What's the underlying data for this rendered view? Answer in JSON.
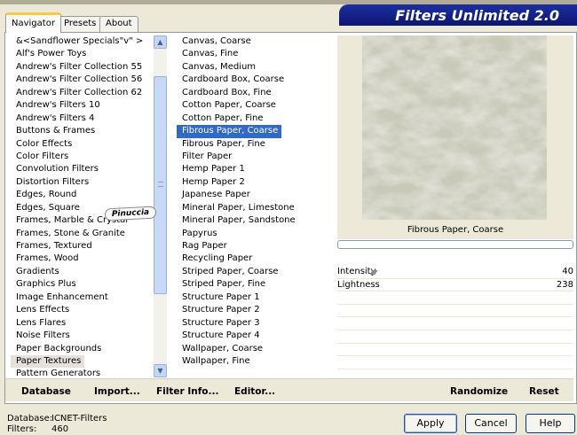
{
  "tabs": [
    "Navigator",
    "Presets",
    "About"
  ],
  "banner": "Filters Unlimited 2.0",
  "categories": [
    "&<Sandflower Specials\"v\" >",
    "Alf's Power Toys",
    "Andrew's Filter Collection 55",
    "Andrew's Filter Collection 56",
    "Andrew's Filter Collection 62",
    "Andrew's Filters 10",
    "Andrew's Filters 4",
    "Buttons & Frames",
    "Color Effects",
    "Color Filters",
    "Convolution Filters",
    "Distortion Filters",
    "Edges, Round",
    "Edges, Square",
    "Frames, Marble & Crystal",
    "Frames, Stone & Granite",
    "Frames, Textured",
    "Frames, Wood",
    "Gradients",
    "Graphics Plus",
    "Image Enhancement",
    "Lens Effects",
    "Lens Flares",
    "Noise Filters",
    "Paper Backgrounds",
    "Paper Textures",
    "Pattern Generators"
  ],
  "selected_category": "Paper Textures",
  "filters": [
    "Canvas, Coarse",
    "Canvas, Fine",
    "Canvas, Medium",
    "Cardboard Box, Coarse",
    "Cardboard Box, Fine",
    "Cotton Paper, Coarse",
    "Cotton Paper, Fine",
    "Fibrous Paper, Coarse",
    "Fibrous Paper, Fine",
    "Filter Paper",
    "Hemp Paper 1",
    "Hemp Paper 2",
    "Japanese Paper",
    "Mineral Paper, Limestone",
    "Mineral Paper, Sandstone",
    "Papyrus",
    "Rag Paper",
    "Recycling Paper",
    "Striped Paper, Coarse",
    "Striped Paper, Fine",
    "Structure Paper 1",
    "Structure Paper 2",
    "Structure Paper 3",
    "Structure Paper 4",
    "Wallpaper, Coarse",
    "Wallpaper, Fine"
  ],
  "selected_filter": "Fibrous Paper, Coarse",
  "watermark": "Pinuccia",
  "preview_filter_name": "Fibrous Paper, Coarse",
  "params": [
    {
      "label": "Intensity",
      "value": "40"
    },
    {
      "label": "Lightness",
      "value": "238"
    }
  ],
  "bottom_buttons": {
    "database": "Database",
    "import": "Import...",
    "filter_info": "Filter Info...",
    "editor": "Editor...",
    "randomize": "Randomize",
    "reset": "Reset"
  },
  "status": {
    "database_label": "Database:",
    "database_value": "ICNET-Filters",
    "filters_label": "Filters:",
    "filters_value": "460"
  },
  "dialog_buttons": {
    "apply": "Apply",
    "cancel": "Cancel",
    "help": "Help"
  },
  "colors": {
    "selection": "#316ac5",
    "banner": "#0c1770",
    "background": "#ece9d8"
  }
}
